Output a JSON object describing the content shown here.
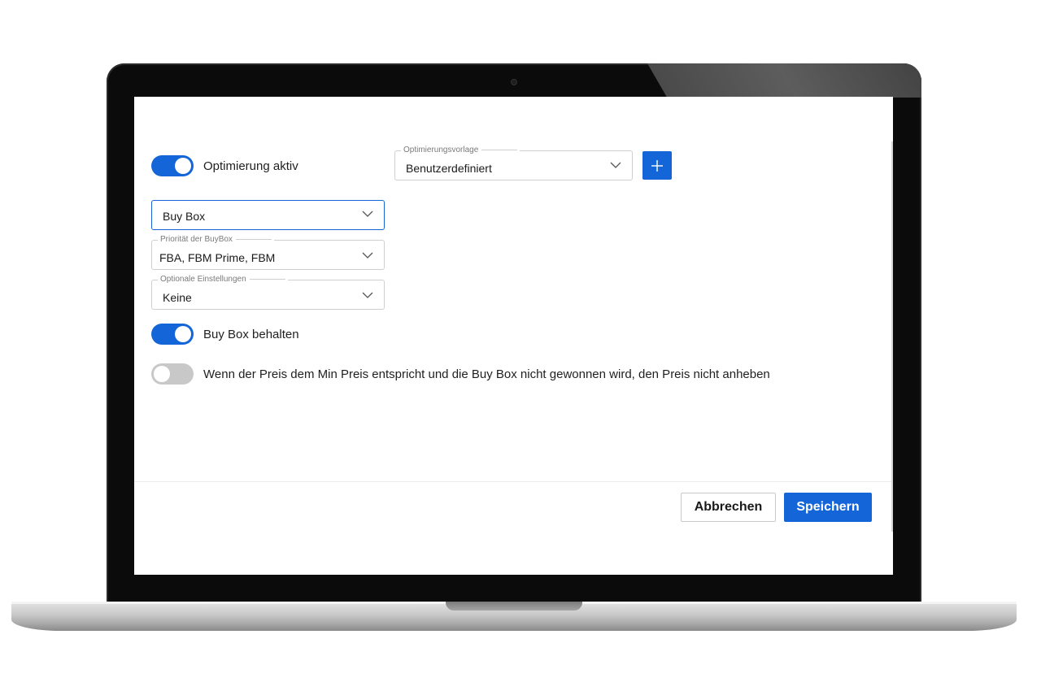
{
  "accent_color": "#1466d8",
  "optimization": {
    "toggle_label": "Optimierung aktiv",
    "toggle_on": true
  },
  "template": {
    "legend": "Optimierungsvorlage",
    "value": "Benutzerdefiniert",
    "add_icon": "plus-icon"
  },
  "strategy": {
    "value": "Buy Box"
  },
  "buybox_priority": {
    "legend": "Priorität der BuyBox",
    "value": "FBA, FBM Prime, FBM"
  },
  "optional_settings": {
    "legend": "Optionale Einstellungen",
    "value": "Keine"
  },
  "keep_buybox": {
    "label": "Buy Box behalten",
    "toggle_on": true
  },
  "no_raise": {
    "label": "Wenn der Preis dem Min Preis entspricht und die Buy Box nicht gewonnen wird, den Preis nicht anheben",
    "toggle_on": false
  },
  "footer": {
    "cancel_label": "Abbrechen",
    "save_label": "Speichern"
  }
}
